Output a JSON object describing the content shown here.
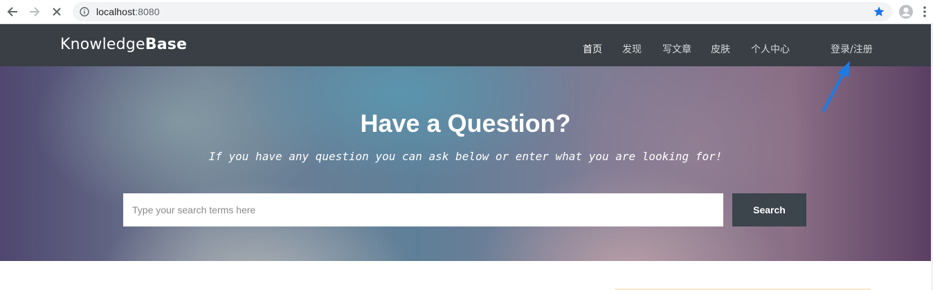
{
  "browser": {
    "url_host": "localhost",
    "url_port": ":8080",
    "accent_color": "#1a73e8",
    "icons": [
      "back-arrow-icon",
      "forward-arrow-icon",
      "stop-icon",
      "info-icon",
      "bookmark-star-icon",
      "profile-icon",
      "menu-dots-icon"
    ]
  },
  "header": {
    "logo_light": "Knowledge",
    "logo_bold": "Base",
    "nav": [
      {
        "label": "首页",
        "active": true
      },
      {
        "label": "发现",
        "active": false
      },
      {
        "label": "写文章",
        "active": false
      },
      {
        "label": "皮肤",
        "active": false
      },
      {
        "label": "个人中心",
        "active": false
      }
    ],
    "login_label": "登录/注册",
    "background_color": "#393f45"
  },
  "hero": {
    "title": "Have a Question?",
    "subtitle": "If you have any question you can ask below or enter what you are looking for!",
    "search": {
      "placeholder": "Type your search terms here",
      "value": "",
      "button_label": "Search",
      "button_color": "#3c444c"
    }
  },
  "annotation": {
    "icon": "pointer-arrow-icon",
    "color": "#1e7be3"
  }
}
